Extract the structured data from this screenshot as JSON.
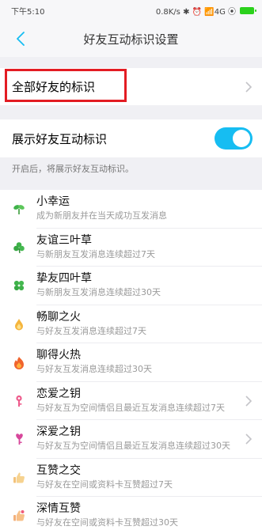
{
  "status": {
    "time": "下午5:10",
    "info": "0.8K/s ✱ ⏰ 📶4G ⦿"
  },
  "nav": {
    "title": "好友互动标识设置"
  },
  "all_marks": {
    "label": "全部好友的标识"
  },
  "toggle_row": {
    "label": "展示好友互动标识",
    "on": true
  },
  "hint": "开启后，将展示好友互动标识。",
  "colors": {
    "accent": "#16bdf2",
    "highlight": "#e31c23",
    "battery": "#2bd11c"
  },
  "marks": [
    {
      "name": "小幸运",
      "desc": "成为新朋友并在当天成功互发消息",
      "icon": "sprout-icon",
      "chevron": false
    },
    {
      "name": "友谊三叶草",
      "desc": "与新朋友互发消息连续超过7天",
      "icon": "clover-icon",
      "chevron": false
    },
    {
      "name": "挚友四叶草",
      "desc": "与新朋友互发消息连续超过30天",
      "icon": "four-leaf-clover-icon",
      "chevron": false
    },
    {
      "name": "畅聊之火",
      "desc": "与好友互发消息连续超过7天",
      "icon": "small-flame-icon",
      "chevron": false
    },
    {
      "name": "聊得火热",
      "desc": "与好友互发消息连续超过30天",
      "icon": "flame-icon",
      "chevron": false
    },
    {
      "name": "恋爱之钥",
      "desc": "与好友互为空间情侣且最近互发消息连续超过7天",
      "icon": "key-icon",
      "chevron": true
    },
    {
      "name": "深爱之钥",
      "desc": "与好友互为空间情侣且最近互发消息连续超过30天",
      "icon": "heart-key-icon",
      "chevron": true
    },
    {
      "name": "互赞之交",
      "desc": "与好友在空间或资料卡互赞超过7天",
      "icon": "thumbs-up-icon",
      "chevron": false
    },
    {
      "name": "深情互赞",
      "desc": "与好友在空间或资料卡互赞超过30天",
      "icon": "gift-thumbs-up-icon",
      "chevron": false
    }
  ]
}
